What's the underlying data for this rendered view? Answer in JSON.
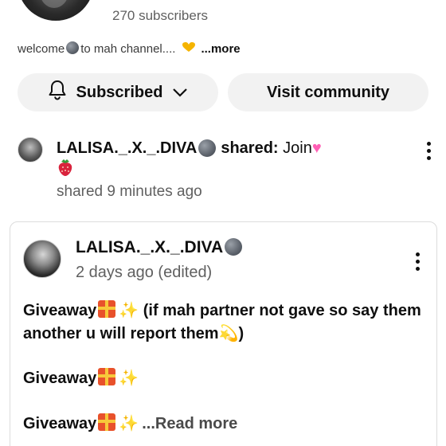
{
  "channel": {
    "subscribers": "270 subscribers",
    "description": "welcome",
    "description_rest": "to mah channel....",
    "more": "...more"
  },
  "buttons": {
    "subscribed": "Subscribed",
    "visit_community": "Visit community"
  },
  "share": {
    "name": "LALISA._.X._.DIVA",
    "verb": "shared:",
    "text": "Join",
    "time": "shared 9 minutes ago"
  },
  "post": {
    "author": "LALISA._.X._.DIVA",
    "time": "2 days ago (edited)",
    "line1_word": "Giveaway",
    "line1_rest": "(if mah partner not gave so say them another u will report them",
    "line1_end": ")",
    "line2_word": "Giveaway",
    "line3_word": "Giveaway",
    "read_more": "...Read more"
  },
  "icons": {
    "bell": "bell-icon",
    "chevron": "chevron-down-icon",
    "moon": "new-moon-face-emoji",
    "heart_hands": "heart-hands-emoji",
    "pink_heart": "pink-heart-emoji",
    "strawberry": "strawberry-emoji",
    "gift": "gift-emoji",
    "sparkles": "sparkles-emoji",
    "dizzy": "dizzy-emoji",
    "kebab": "more-vertical-icon"
  }
}
